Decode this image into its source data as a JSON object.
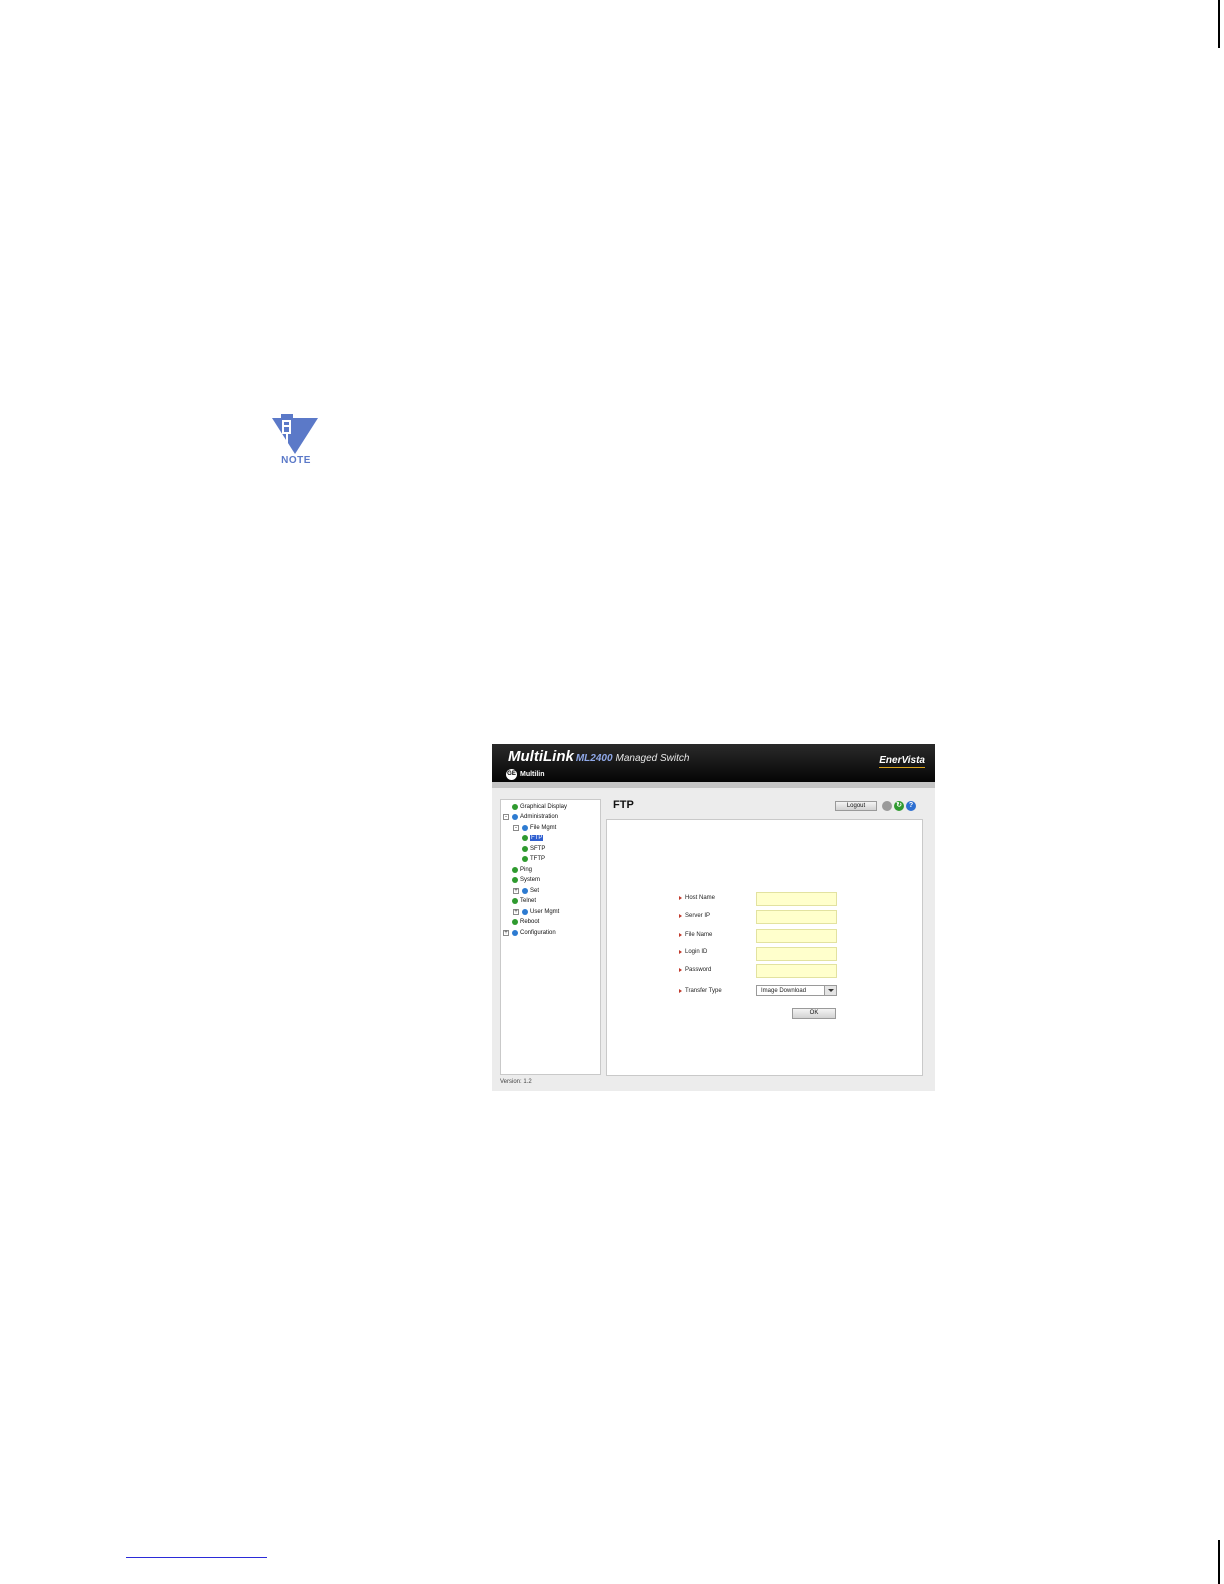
{
  "note_label": "NOTE",
  "app": {
    "brand": {
      "name": "MultiLink",
      "model": "ML2400",
      "product": "Managed Switch",
      "sub_logo": "GE",
      "sub": "Multilin",
      "right_logo": "EnerVista"
    },
    "sidebar": {
      "items": [
        {
          "label": "Graphical Display",
          "icon": "green",
          "toggle": ""
        },
        {
          "label": "Administration",
          "icon": "blue",
          "toggle": "-"
        },
        {
          "label": "File Mgmt",
          "icon": "blue",
          "toggle": "-"
        },
        {
          "label": "FTP",
          "icon": "green",
          "toggle": "",
          "selected": true
        },
        {
          "label": "SFTP",
          "icon": "green",
          "toggle": ""
        },
        {
          "label": "TFTP",
          "icon": "green",
          "toggle": ""
        },
        {
          "label": "Ping",
          "icon": "green",
          "toggle": ""
        },
        {
          "label": "System",
          "icon": "green",
          "toggle": ""
        },
        {
          "label": "Set",
          "icon": "blue",
          "toggle": "+"
        },
        {
          "label": "Telnet",
          "icon": "green",
          "toggle": ""
        },
        {
          "label": "User Mgmt",
          "icon": "blue",
          "toggle": "+"
        },
        {
          "label": "Reboot",
          "icon": "green",
          "toggle": ""
        },
        {
          "label": "Configuration",
          "icon": "blue",
          "toggle": "+"
        }
      ]
    },
    "main": {
      "title": "FTP",
      "logout_label": "Logout",
      "icons": [
        "save-icon",
        "refresh-icon",
        "help-icon"
      ],
      "help_glyph": "?",
      "form": {
        "fields": [
          {
            "label": "Host Name",
            "value": ""
          },
          {
            "label": "Server IP",
            "value": ""
          },
          {
            "label": "File Name",
            "value": ""
          },
          {
            "label": "Login ID",
            "value": ""
          },
          {
            "label": "Password",
            "value": ""
          }
        ],
        "transfer_type_label": "Transfer Type",
        "transfer_type_value": "Image Download",
        "ok_label": "OK"
      }
    },
    "version": "Version: 1.2"
  },
  "colors": {
    "header_bg": "#050505",
    "input_bg": "#ffffcc",
    "selected_bg": "#2f5fd0",
    "note_blue": "#5b79c8",
    "accent_gold": "#d9a21a"
  }
}
